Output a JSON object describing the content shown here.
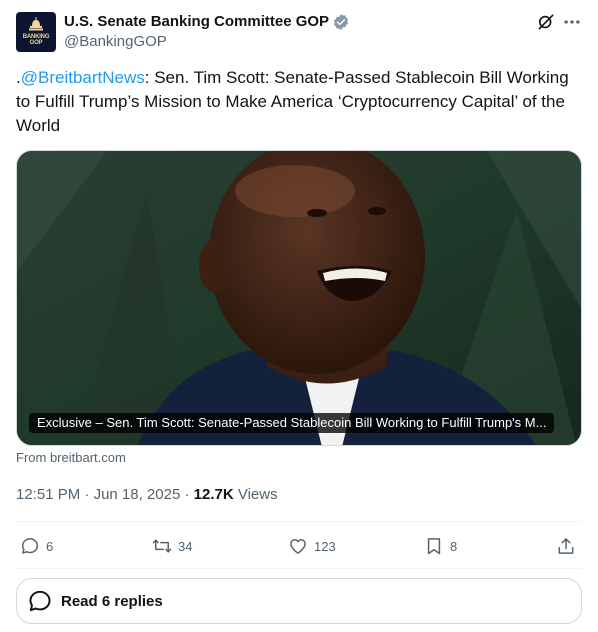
{
  "author": {
    "display_name": "U.S. Senate Banking Committee GOP",
    "handle": "@BankingGOP",
    "avatar_text": "BANKING GOP",
    "verified_color": "#829aab"
  },
  "tweet": {
    "prefix": ".",
    "mention": "@BreitbartNews",
    "body": ": Sen. Tim Scott: Senate-Passed Stablecoin Bill Working to Fulfill Trump’s Mission to Make America ‘Cryptocurrency Capital’ of the World"
  },
  "media": {
    "caption": "Exclusive – Sen. Tim Scott: Senate-Passed Stablecoin Bill Working to Fulfill Trump's M...",
    "source": "From breitbart.com"
  },
  "meta": {
    "time": "12:51 PM",
    "separator": "·",
    "date": "Jun 18, 2025",
    "views_count": "12.7K",
    "views_label": "Views"
  },
  "actions": {
    "replies": "6",
    "reposts": "34",
    "likes": "123",
    "bookmarks": "8"
  },
  "read_replies_label": "Read 6 replies",
  "colors": {
    "accent": "#1d9bf0",
    "muted": "#536471",
    "text": "#0f1419"
  },
  "icons": [
    "verified-badge-icon",
    "grok-icon",
    "more-icon",
    "reply-icon",
    "repost-icon",
    "like-icon",
    "bookmark-icon",
    "share-icon",
    "replies-bubble-icon"
  ]
}
